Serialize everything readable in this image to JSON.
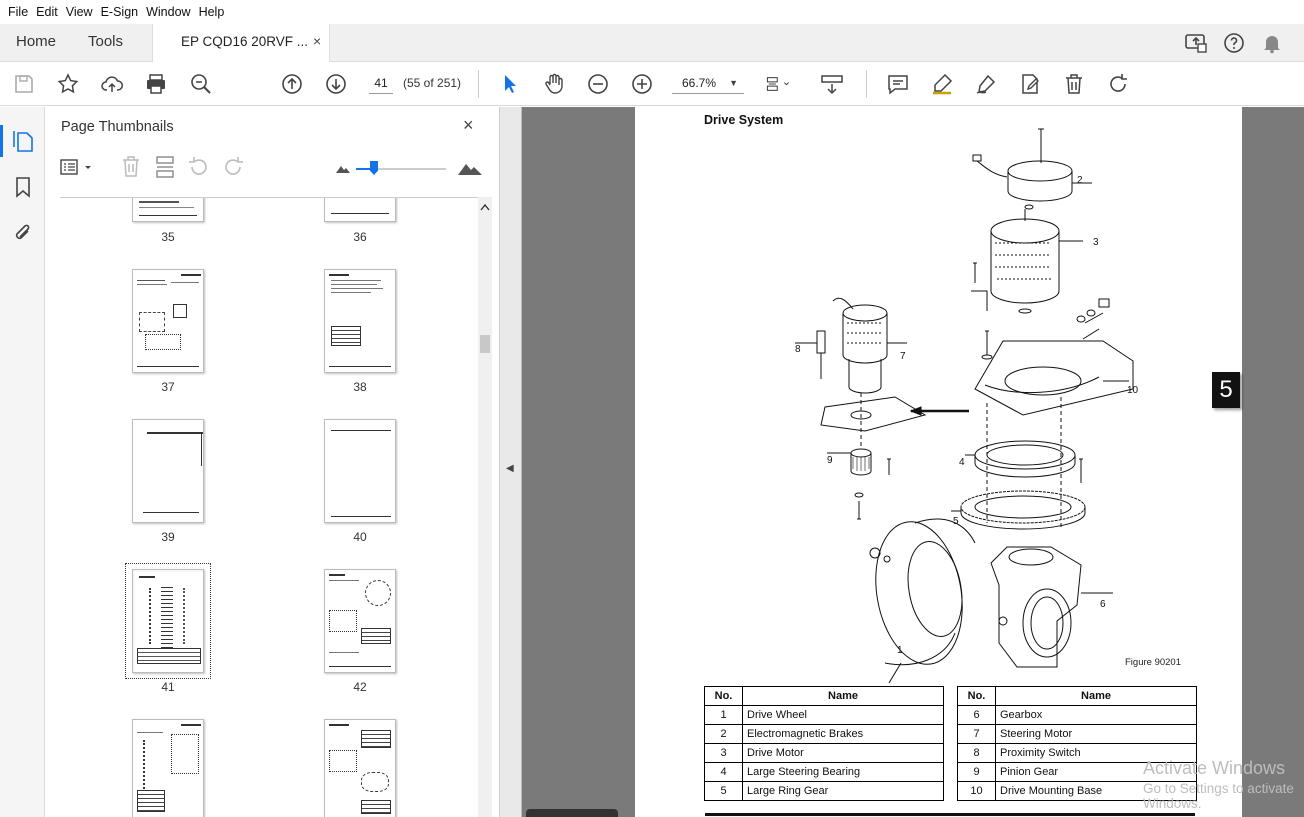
{
  "menu": {
    "items": [
      "File",
      "Edit",
      "View",
      "E-Sign",
      "Window",
      "Help"
    ]
  },
  "tabs": {
    "home": "Home",
    "tools": "Tools",
    "document": "EP CQD16 20RVF ...",
    "close": "×"
  },
  "toolbar": {
    "page_current": "41",
    "page_count": "(55 of 251)",
    "zoom": "66.7%"
  },
  "panel": {
    "title": "Page Thumbnails",
    "close": "×"
  },
  "thumbnails": [
    {
      "label": "35"
    },
    {
      "label": "36"
    },
    {
      "label": "37"
    },
    {
      "label": "38"
    },
    {
      "label": "39"
    },
    {
      "label": "40"
    },
    {
      "label": "41"
    },
    {
      "label": "42"
    }
  ],
  "document": {
    "title": "Drive System",
    "figure_label": "Figure 90201",
    "callouts": [
      "2",
      "3",
      "7",
      "8",
      "10",
      "4",
      "9",
      "5",
      "6",
      "1"
    ],
    "table_headers": {
      "no": "No.",
      "name": "Name"
    },
    "parts_left": [
      {
        "no": "1",
        "name": "Drive Wheel"
      },
      {
        "no": "2",
        "name": "Electromagnetic Brakes"
      },
      {
        "no": "3",
        "name": "Drive Motor"
      },
      {
        "no": "4",
        "name": "Large Steering Bearing"
      },
      {
        "no": "5",
        "name": "Large Ring Gear"
      }
    ],
    "parts_right": [
      {
        "no": "6",
        "name": "Gearbox"
      },
      {
        "no": "7",
        "name": "Steering Motor"
      },
      {
        "no": "8",
        "name": "Proximity Switch"
      },
      {
        "no": "9",
        "name": "Pinion Gear"
      },
      {
        "no": "10",
        "name": "Drive Mounting Base"
      }
    ]
  },
  "page_badge": "5",
  "watermark": {
    "line1": "Activate Windows",
    "line2": "Go to Settings to activate Windows."
  }
}
